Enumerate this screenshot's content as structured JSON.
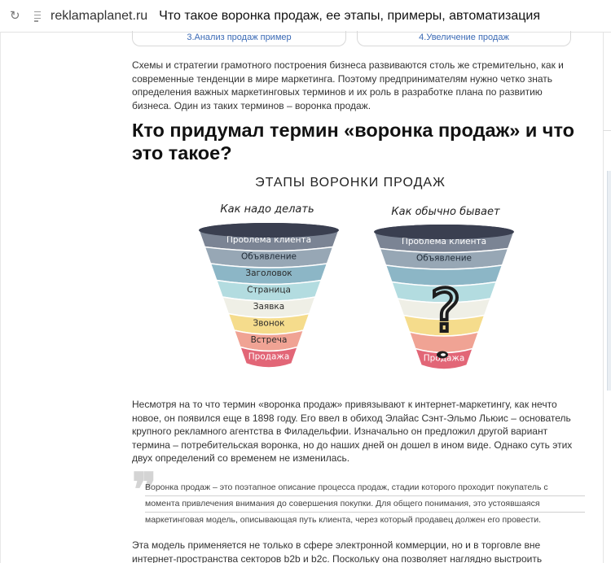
{
  "browser": {
    "domain": "reklamaplanet.ru",
    "title": "Что такое воронка продаж, ее этапы, примеры, автоматизация"
  },
  "toc": {
    "item_a": "3.Анализ продаж пример",
    "item_b": "4.Увеличение продаж"
  },
  "article": {
    "intro": "Схемы и стратегии грамотного построения бизнеса развиваются столь же стремительно, как и современные тенденции в мире маркетинга. Поэтому предпринимателям нужно четко знать определения важных маркетинговых терминов и их роль в разработке плана по развитию бизнеса. Один из таких терминов – воронка продаж.",
    "heading": "Кто придумал термин «воронка продаж» и что это такое?",
    "history": "Несмотря на то что термин «воронка продаж» привязывают к интернет-маркетингу, как нечто новое, он появился еще в 1898 году. Его ввел в обиход Элайас Сэнт-Эльмо Льюис – основатель крупного рекламного агентства в Филадельфии. Изначально он предложил другой вариант термина – потребительская воронка, но до наших дней он дошел в ином виде. Однако суть этих двух определений со временем не изменилась.",
    "quote_lines": [
      "Воронка продаж – это поэтапное описание процесса продаж, стадии которого проходит покупатель с",
      "момента привлечения внимания до совершения покупки. Для общего понимания, это устоявшаяся",
      "маркетинговая модель, описывающая путь клиента, через который продавец должен его провести."
    ],
    "next_para": "Эта модель применяется не только в сфере электронной коммерции, но и в торговле вне интернет-пространства секторов b2b и b2c. Поскольку она позволяет наглядно выстроить"
  },
  "infographic": {
    "title": "ЭТАПЫ ВОРОНКИ ПРОДАЖ",
    "left_caption": "Как надо делать",
    "right_caption": "Как обычно бывает",
    "left_stages": [
      "Проблема клиента",
      "Объявление",
      "Заголовок",
      "Страница",
      "Заявка",
      "Звонок",
      "Встреча",
      "Продажа"
    ],
    "right_stages": [
      "Проблема клиента",
      "Объявление",
      "",
      "",
      "",
      "",
      "",
      "Продажа"
    ],
    "question_mark": "?",
    "colors": [
      "#7b8494",
      "#97a7b5",
      "#8cb6c6",
      "#b3dce0",
      "#efefe6",
      "#f5dc8c",
      "#f0a394",
      "#e26677"
    ],
    "rim_color": "#3a3f50"
  }
}
